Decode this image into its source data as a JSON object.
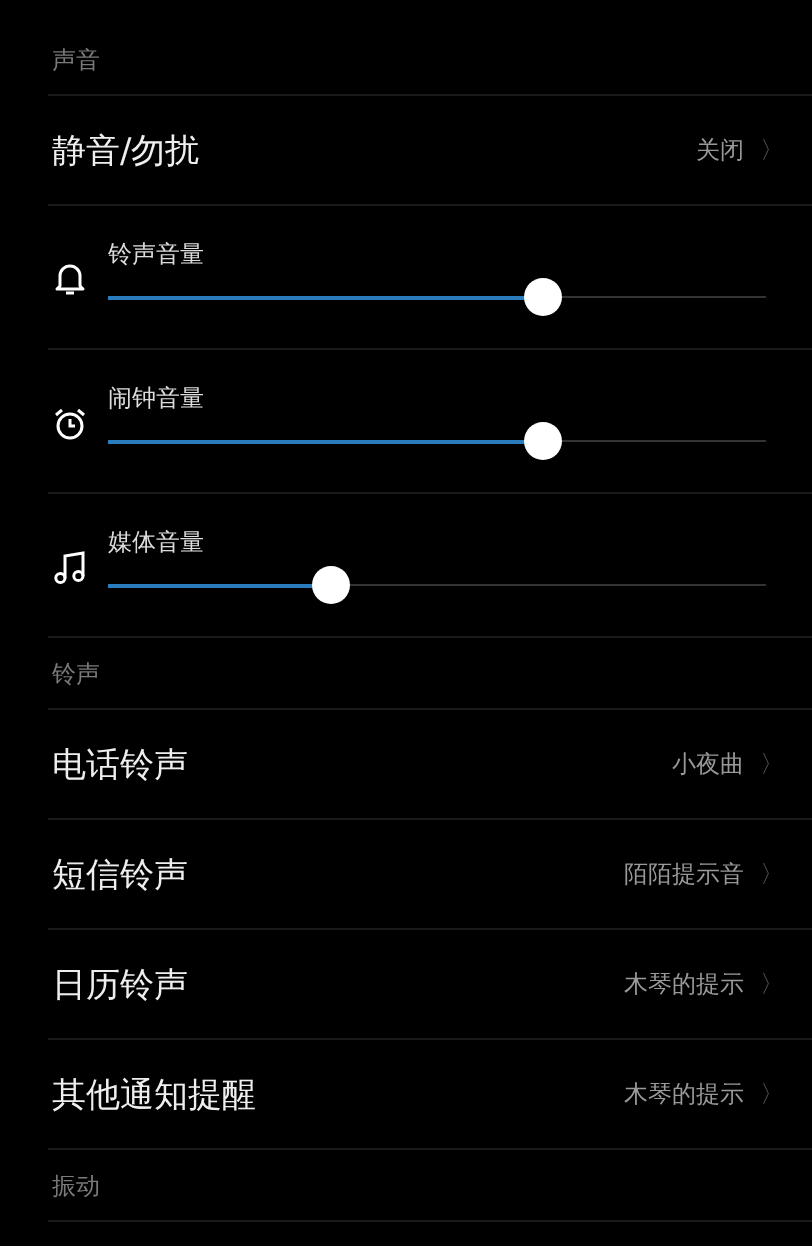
{
  "sections": [
    {
      "title": "声音",
      "items": [
        {
          "kind": "link",
          "label": "静音/勿扰",
          "value": "关闭",
          "chevron": "〉"
        },
        {
          "kind": "slider",
          "label": "铃声音量",
          "level": 0.66
        },
        {
          "kind": "slider",
          "label": "闹钟音量",
          "level": 0.66
        },
        {
          "kind": "slider",
          "label": "媒体音量",
          "level": 0.34
        }
      ]
    },
    {
      "title": "铃声",
      "items": [
        {
          "kind": "link",
          "label": "电话铃声",
          "value": "小夜曲",
          "chevron": "〉"
        },
        {
          "kind": "link",
          "label": "短信铃声",
          "value": "陌陌提示音",
          "chevron": "〉"
        },
        {
          "kind": "link",
          "label": "日历铃声",
          "value": "木琴的提示",
          "chevron": "〉"
        },
        {
          "kind": "link",
          "label": "其他通知提醒",
          "value": "木琴的提示",
          "chevron": "〉"
        }
      ]
    },
    {
      "title": "振动"
    }
  ]
}
